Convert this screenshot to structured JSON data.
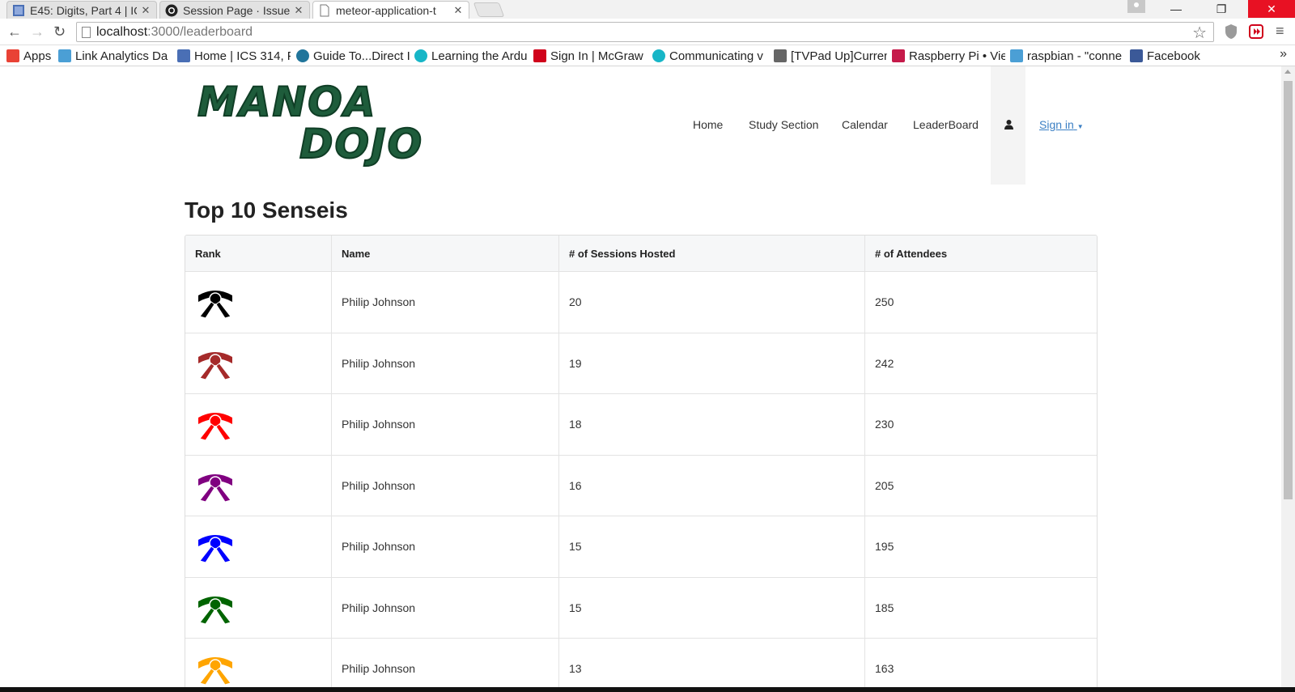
{
  "browser": {
    "tabs": [
      {
        "title": "E45: Digits, Part 4 | IC",
        "favicon": "page-icon"
      },
      {
        "title": "Session Page · Issue",
        "favicon": "github-icon"
      },
      {
        "title": "meteor-application-t",
        "favicon": "page-icon"
      }
    ],
    "url_host": "localhost",
    "url_path": ":3000/leaderboard",
    "bookmarks": [
      {
        "label": "Apps",
        "icon": "apps-grid-icon",
        "color": "#e94235"
      },
      {
        "label": "Link Analytics Da",
        "icon": "tuc-icon",
        "color": "#4b9fd5"
      },
      {
        "label": "Home | ICS 314, F",
        "icon": "page-icon",
        "color": "#4a6fb5"
      },
      {
        "label": "Guide To...Direct I",
        "icon": "wordpress-icon",
        "color": "#21759b"
      },
      {
        "label": "Learning the Ardu",
        "icon": "circle-icon",
        "color": "#17b6c7"
      },
      {
        "label": "Sign In | McGraw",
        "icon": "m-icon",
        "color": "#d0021b"
      },
      {
        "label": "Communicating v",
        "icon": "circle-icon",
        "color": "#17b6c7"
      },
      {
        "label": "[TVPad Up]Curren",
        "icon": "doc-icon",
        "color": "#666666"
      },
      {
        "label": "Raspberry Pi • Vie",
        "icon": "raspberry-icon",
        "color": "#c51a4a"
      },
      {
        "label": "raspbian - \"conne",
        "icon": "rpi-icon",
        "color": "#4b9fd5"
      },
      {
        "label": "Facebook",
        "icon": "facebook-icon",
        "color": "#3b5998"
      }
    ],
    "bookmarks_more": "»"
  },
  "site": {
    "logo_line1": "MANOA",
    "logo_line2": "DOJO",
    "nav": [
      "Home",
      "Study Section",
      "Calendar",
      "LeaderBoard"
    ],
    "signin": "Sign in",
    "signin_caret": "▼"
  },
  "leaderboard": {
    "title": "Top 10 Senseis",
    "columns": [
      "Rank",
      "Name",
      "# of Sessions Hosted",
      "# of Attendees"
    ],
    "rows": [
      {
        "belt": "#000000",
        "name": "Philip Johnson",
        "sessions": "20",
        "attendees": "250"
      },
      {
        "belt": "#a52a2a",
        "name": "Philip Johnson",
        "sessions": "19",
        "attendees": "242"
      },
      {
        "belt": "#ff0000",
        "name": "Philip Johnson",
        "sessions": "18",
        "attendees": "230"
      },
      {
        "belt": "#800080",
        "name": "Philip Johnson",
        "sessions": "16",
        "attendees": "205"
      },
      {
        "belt": "#0000ff",
        "name": "Philip Johnson",
        "sessions": "15",
        "attendees": "195"
      },
      {
        "belt": "#006400",
        "name": "Philip Johnson",
        "sessions": "15",
        "attendees": "185"
      },
      {
        "belt": "#ffa500",
        "name": "Philip Johnson",
        "sessions": "13",
        "attendees": "163"
      }
    ]
  },
  "colors": {
    "logo": "#1e5c3b",
    "link": "#3b7fc4",
    "close_button": "#e81123"
  }
}
